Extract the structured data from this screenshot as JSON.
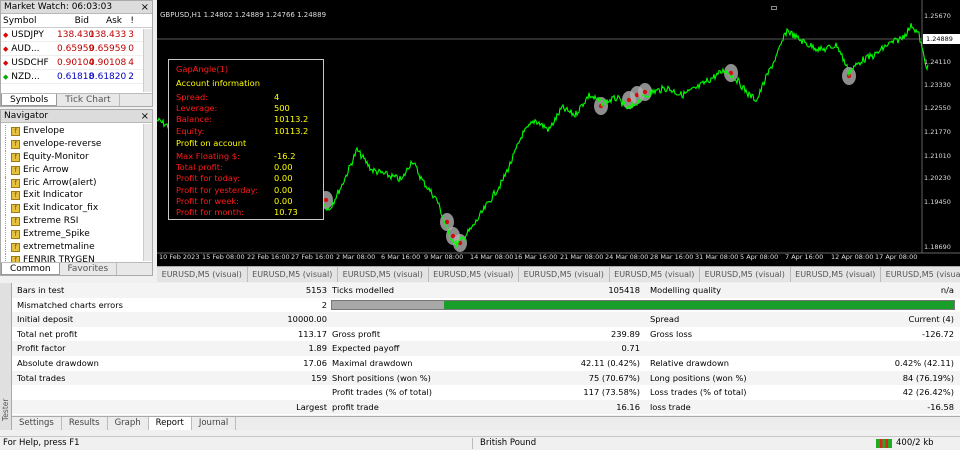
{
  "market_watch": {
    "title": "Market Watch: 06:03:03",
    "headers": [
      "Symbol",
      "Bid",
      "Ask",
      "!"
    ],
    "rows": [
      {
        "symbol": "USDJPY",
        "bid": "138.430",
        "ask": "138.433",
        "spread": "3",
        "color": "#c00000",
        "dir": "down"
      },
      {
        "symbol": "AUD...",
        "bid": "0.65959",
        "ask": "0.65959",
        "spread": "0",
        "color": "#c00000",
        "dir": "down"
      },
      {
        "symbol": "USDCHF",
        "bid": "0.90104",
        "ask": "0.90108",
        "spread": "4",
        "color": "#c00000",
        "dir": "down"
      },
      {
        "symbol": "NZD...",
        "bid": "0.61818",
        "ask": "0.61820",
        "spread": "2",
        "color": "#0000c0",
        "dir": "up"
      }
    ],
    "tabs": [
      "Symbols",
      "Tick Chart"
    ]
  },
  "navigator": {
    "title": "Navigator",
    "items": [
      "Envelope",
      "envelope-reverse",
      "Equity-Monitor",
      "Eric Arrow",
      "Eric Arrow(alert)",
      "Exit Indicator",
      "Exit Indicator_fix",
      "Extreme RSI",
      "Extreme_Spike",
      "extremetmaline",
      "FENRIR TRYGEN"
    ],
    "tabs": [
      "Common",
      "Favorites"
    ]
  },
  "chart": {
    "header": "GBPUSD,H1  1.24802 1.24889 1.24766 1.24889",
    "current_price": "1.24889",
    "price_labels": [
      "1.25670",
      "1.24889",
      "1.24110",
      "1.23330",
      "1.22550",
      "1.21770",
      "1.21010",
      "1.20230",
      "1.19450",
      "1.18690"
    ],
    "x_labels": [
      "10 Feb 2023",
      "15 Feb 08:00",
      "22 Feb 16:00",
      "27 Feb 16:00",
      "2 Mar 08:00",
      "6 Mar 16:00",
      "9 Mar 08:00",
      "14 Mar 08:00",
      "16 Mar 16:00",
      "21 Mar 08:00",
      "24 Mar 08:00",
      "28 Mar 16:00",
      "31 Mar 08:00",
      "5 Apr 08:00",
      "7 Apr 16:00",
      "12 Apr 08:00",
      "17 Apr 08:00"
    ],
    "line_color": "#00ff00"
  },
  "info_panel": {
    "title": "GapAngle(1)",
    "section1": "Account information",
    "rows1": [
      {
        "label": "Spread:",
        "value": "4"
      },
      {
        "label": "Leverage:",
        "value": "500"
      },
      {
        "label": "Balance:",
        "value": "10113.2"
      },
      {
        "label": "Equity:",
        "value": "10113.2"
      }
    ],
    "section2": "Profit on account",
    "rows2": [
      {
        "label": "Max Floating $:",
        "value": "-16.2"
      },
      {
        "label": "Total profit:",
        "value": "0.00"
      },
      {
        "label": "Profit for today:",
        "value": "0.00"
      },
      {
        "label": "Profit for yesterday:",
        "value": "0.00"
      },
      {
        "label": "Profit for week:",
        "value": "0.00"
      },
      {
        "label": "Profit for month:",
        "value": "10.73"
      }
    ]
  },
  "visual_tabs": [
    "EURUSD,M5 (visual)",
    "EURUSD,M5 (visual)",
    "EURUSD,M5 (visual)",
    "EURUSD,M5 (visual)",
    "EURUSD,M5 (visual)",
    "EURUSD,M5 (visual)",
    "EURUSD,M5 (visual)",
    "EURUSD,M5 (visual)",
    "EURUSD,M5 (visual)"
  ],
  "report": {
    "bars_label": "Bars in test",
    "bars_value": "5153",
    "ticks_label": "Ticks modelled",
    "ticks_value": "105418",
    "quality_label": "Modelling quality",
    "quality_value": "n/a",
    "mismatch_label": "Mismatched charts errors",
    "mismatch_value": "2",
    "initial_label": "Initial deposit",
    "initial_value": "10000.00",
    "spread_label": "Spread",
    "spread_value": "Current (4)",
    "net_label": "Total net profit",
    "net_value": "113.17",
    "gross_profit_label": "Gross profit",
    "gross_profit_value": "239.89",
    "gross_loss_label": "Gross loss",
    "gross_loss_value": "-126.72",
    "pf_label": "Profit factor",
    "pf_value": "1.89",
    "ep_label": "Expected payoff",
    "ep_value": "0.71",
    "abs_dd_label": "Absolute drawdown",
    "abs_dd_value": "17.06",
    "max_dd_label": "Maximal drawdown",
    "max_dd_value": "42.11 (0.42%)",
    "rel_dd_label": "Relative drawdown",
    "rel_dd_value": "0.42% (42.11)",
    "trades_label": "Total trades",
    "trades_value": "159",
    "short_label": "Short positions (won %)",
    "short_value": "75 (70.67%)",
    "long_label": "Long positions (won %)",
    "long_value": "84 (76.19%)",
    "ptrades_label": "Profit trades (% of total)",
    "ptrades_value": "117 (73.58%)",
    "ltrades_label": "Loss trades (% of total)",
    "ltrades_value": "42 (26.42%)",
    "largest_label": "Largest",
    "lp_label": "profit trade",
    "lp_value": "16.16",
    "ll_label": "loss trade",
    "ll_value": "-16.58",
    "quality_fill": 0.82
  },
  "tester_tabs": [
    "Settings",
    "Results",
    "Graph",
    "Report",
    "Journal"
  ],
  "tester_side_label": "Tester",
  "status": {
    "help": "For Help, press F1",
    "profile": "British Pound",
    "traffic": "400/2 kb"
  }
}
